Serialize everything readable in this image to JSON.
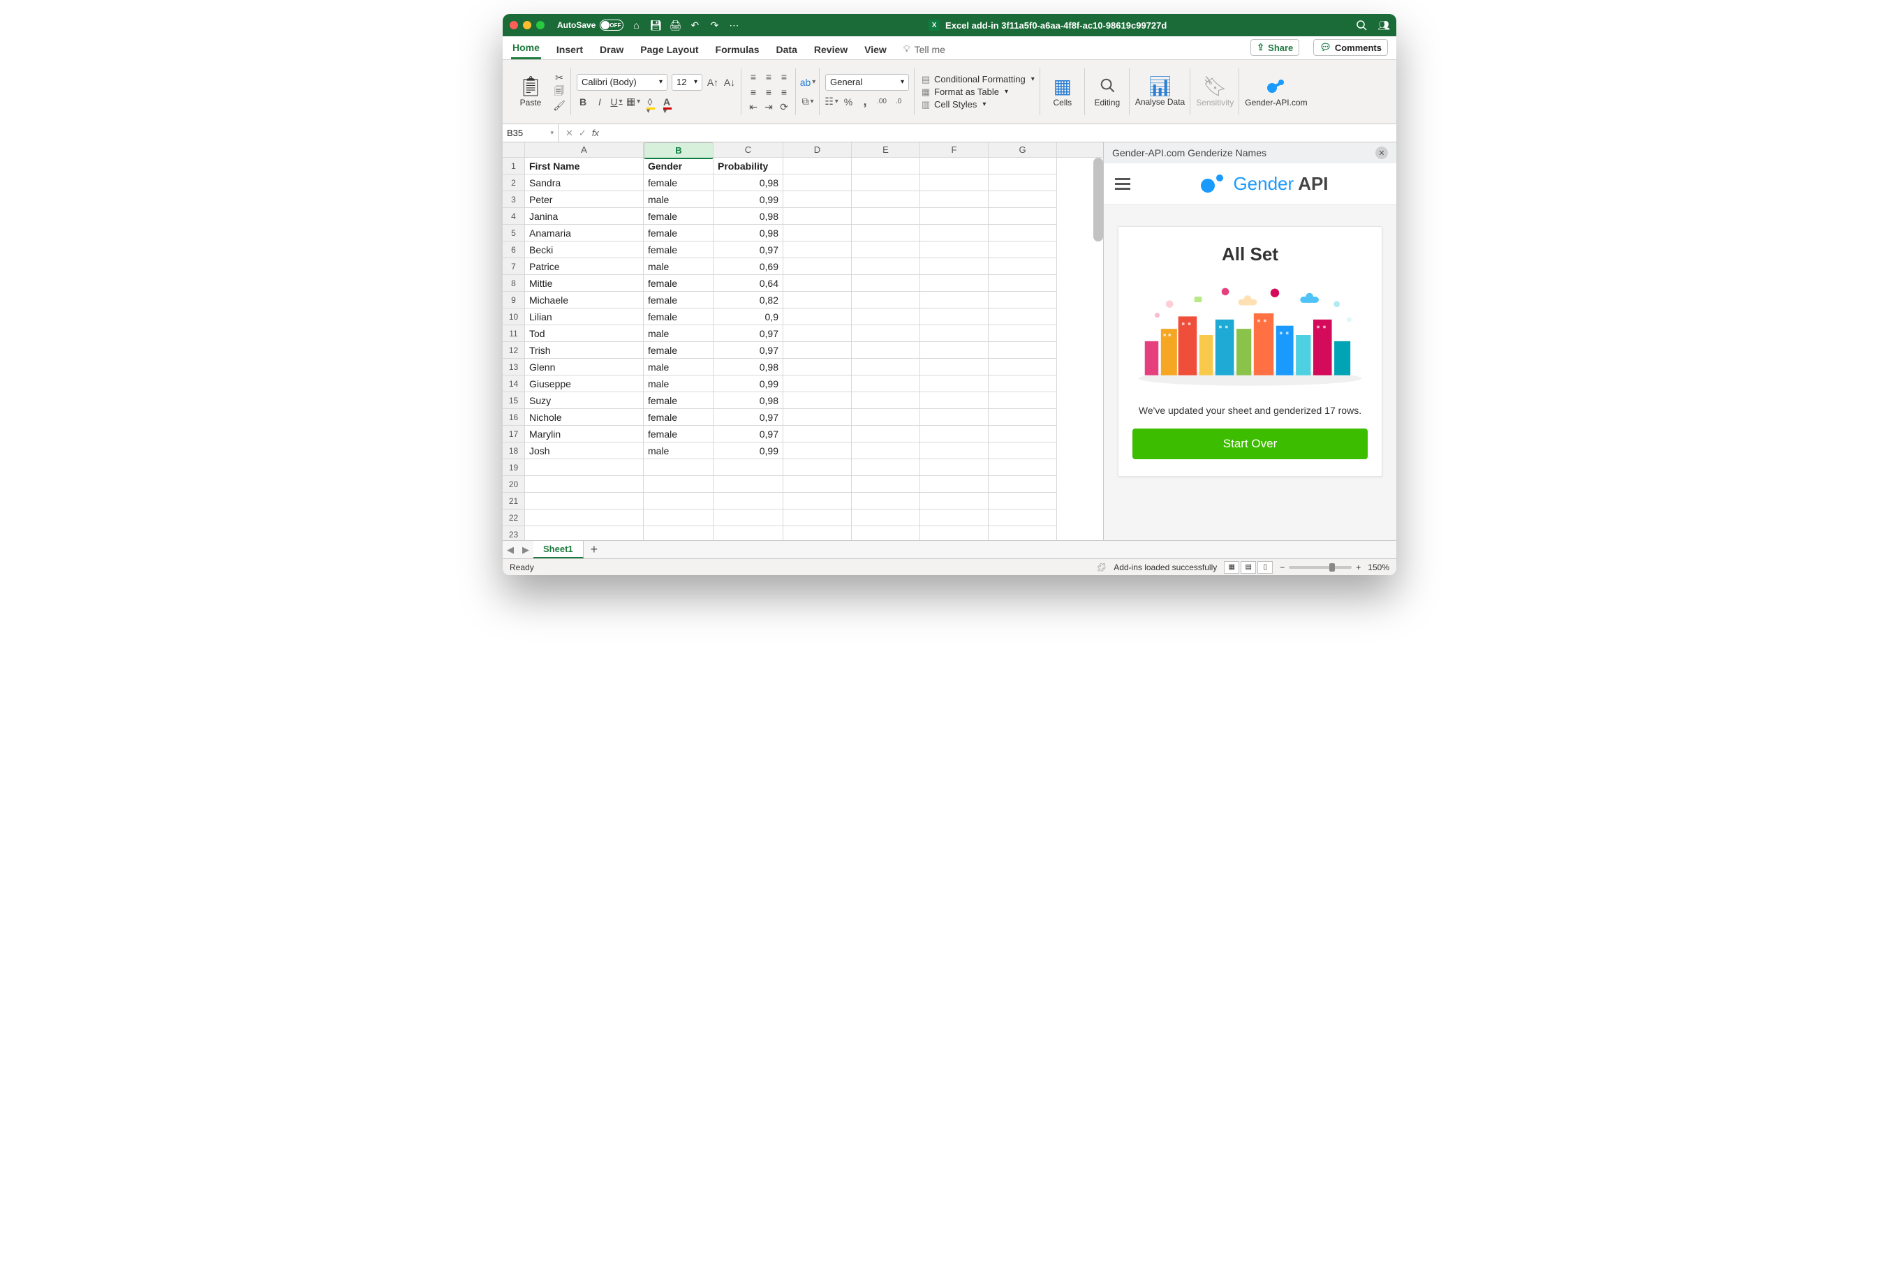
{
  "titlebar": {
    "autosave_label": "AutoSave",
    "autosave_state": "OFF",
    "doc_title": "Excel add-in 3f11a5f0-a6aa-4f8f-ac10-98619c99727d"
  },
  "tabs": {
    "items": [
      "Home",
      "Insert",
      "Draw",
      "Page Layout",
      "Formulas",
      "Data",
      "Review",
      "View"
    ],
    "active": "Home",
    "tellme": "Tell me",
    "share": "Share",
    "comments": "Comments"
  },
  "ribbon": {
    "paste": "Paste",
    "font_name": "Calibri (Body)",
    "font_size": "12",
    "number_format": "General",
    "cond_fmt": "Conditional Formatting",
    "fmt_table": "Format as Table",
    "cell_styles": "Cell Styles",
    "cells": "Cells",
    "editing": "Editing",
    "analyse": "Analyse Data",
    "sensitivity": "Sensitivity",
    "gender_api": "Gender-API.com"
  },
  "formula_bar": {
    "cell_ref": "B35"
  },
  "columns": [
    "A",
    "B",
    "C",
    "D",
    "E",
    "F",
    "G"
  ],
  "headers": {
    "a": "First Name",
    "b": "Gender",
    "c": "Probability"
  },
  "rows": [
    {
      "n": "Sandra",
      "g": "female",
      "p": "0,98"
    },
    {
      "n": "Peter",
      "g": "male",
      "p": "0,99"
    },
    {
      "n": "Janina",
      "g": "female",
      "p": "0,98"
    },
    {
      "n": "Anamaria",
      "g": "female",
      "p": "0,98"
    },
    {
      "n": "Becki",
      "g": "female",
      "p": "0,97"
    },
    {
      "n": "Patrice",
      "g": "male",
      "p": "0,69"
    },
    {
      "n": "Mittie",
      "g": "female",
      "p": "0,64"
    },
    {
      "n": "Michaele",
      "g": "female",
      "p": "0,82"
    },
    {
      "n": "Lilian",
      "g": "female",
      "p": "0,9"
    },
    {
      "n": "Tod",
      "g": "male",
      "p": "0,97"
    },
    {
      "n": "Trish",
      "g": "female",
      "p": "0,97"
    },
    {
      "n": "Glenn",
      "g": "male",
      "p": "0,98"
    },
    {
      "n": "Giuseppe",
      "g": "male",
      "p": "0,99"
    },
    {
      "n": "Suzy",
      "g": "female",
      "p": "0,98"
    },
    {
      "n": "Nichole",
      "g": "female",
      "p": "0,97"
    },
    {
      "n": "Marylin",
      "g": "female",
      "p": "0,97"
    },
    {
      "n": "Josh",
      "g": "male",
      "p": "0,99"
    }
  ],
  "empty_rows": [
    19,
    20,
    21,
    22,
    23
  ],
  "pane": {
    "title": "Gender-API.com Genderize Names",
    "logo1": "Gender",
    "logo2": "API",
    "heading": "All Set",
    "message": "We've updated your sheet and genderized 17 rows.",
    "button": "Start Over"
  },
  "sheet_tab": "Sheet1",
  "status": {
    "ready": "Ready",
    "addins": "Add-ins loaded successfully",
    "zoom": "150%"
  }
}
